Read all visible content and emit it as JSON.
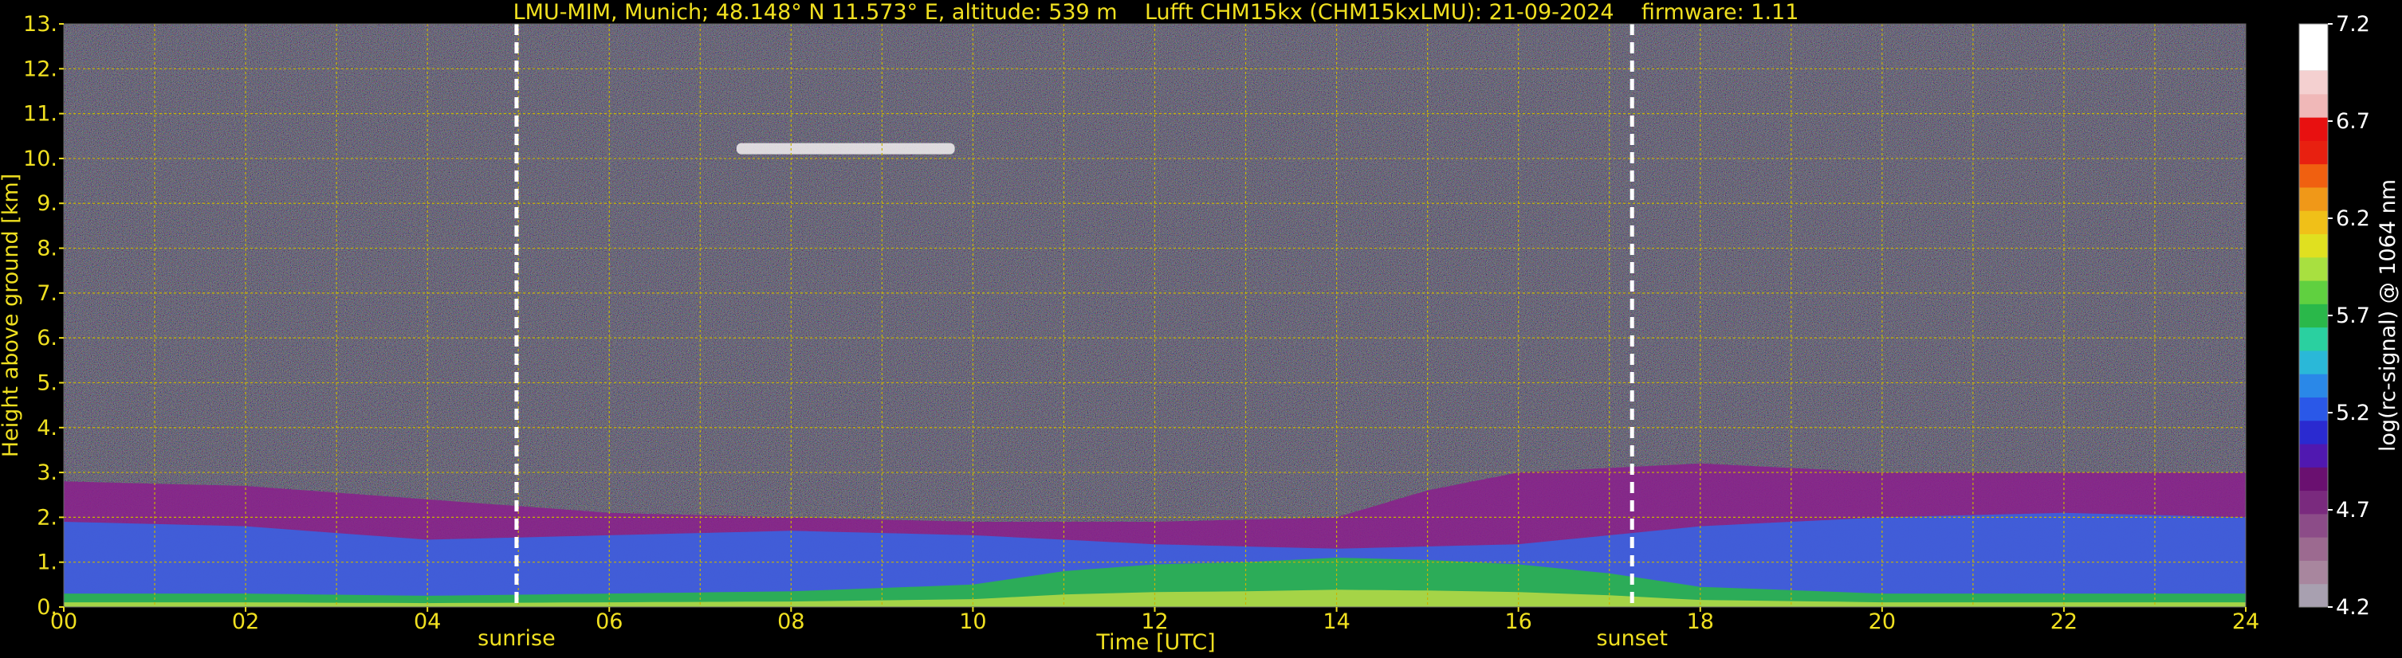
{
  "chart_data": {
    "type": "heatmap",
    "title": "LMU-MIM, Munich; 48.148° N 11.573° E, altitude: 539 m    Lufft CHM15kx (CHM15kxLMU): 21-09-2024    firmware: 1.11",
    "xlabel": "Time [UTC]",
    "ylabel": "Height above ground [km]",
    "colorbar_label": "log(rc-signal) @ 1064 nm",
    "xlim": [
      0,
      24
    ],
    "ylim": [
      0,
      13
    ],
    "x_ticks": [
      "00",
      "02",
      "04",
      "06",
      "08",
      "10",
      "12",
      "14",
      "16",
      "18",
      "20",
      "22",
      "24"
    ],
    "y_ticks": [
      "0.",
      "1.",
      "2.",
      "3.",
      "4.",
      "5.",
      "6.",
      "7.",
      "8.",
      "9.",
      "10.",
      "11.",
      "12.",
      "13."
    ],
    "colorbar_range": [
      4.2,
      7.2
    ],
    "colorbar_ticks": [
      "7.2",
      "6.7",
      "6.2",
      "5.7",
      "5.2",
      "4.7",
      "4.2"
    ],
    "grid": true,
    "markers": [
      {
        "label": "sunrise",
        "x": 4.98
      },
      {
        "label": "sunset",
        "x": 17.25
      }
    ],
    "layers": [
      {
        "name": "near-surface layer",
        "x": [
          0,
          2,
          4,
          6,
          8,
          10,
          11,
          12,
          13,
          14,
          15,
          16,
          17,
          18,
          20,
          22,
          24
        ],
        "top_km": [
          0.3,
          0.3,
          0.25,
          0.3,
          0.35,
          0.5,
          0.8,
          0.95,
          1.0,
          1.1,
          1.05,
          0.95,
          0.75,
          0.45,
          0.3,
          0.3,
          0.3
        ]
      },
      {
        "name": "boundary layer (blue)",
        "x": [
          0,
          2,
          4,
          6,
          8,
          10,
          12,
          14,
          16,
          18,
          20,
          22,
          24
        ],
        "top_km": [
          1.9,
          1.8,
          1.5,
          1.6,
          1.7,
          1.6,
          1.4,
          1.3,
          1.4,
          1.8,
          2.0,
          2.1,
          2.0
        ]
      },
      {
        "name": "residual layer (purple)",
        "x": [
          0,
          2,
          4,
          6,
          8,
          10,
          12,
          14,
          15,
          16,
          18,
          20,
          22,
          24
        ],
        "top_km": [
          2.8,
          2.7,
          2.4,
          2.1,
          2.0,
          1.9,
          1.9,
          2.0,
          2.6,
          3.0,
          3.2,
          3.0,
          3.0,
          3.0
        ]
      },
      {
        "name": "high cloud",
        "x_start": 7.4,
        "x_end": 9.8,
        "height_km": 10.2
      }
    ]
  }
}
